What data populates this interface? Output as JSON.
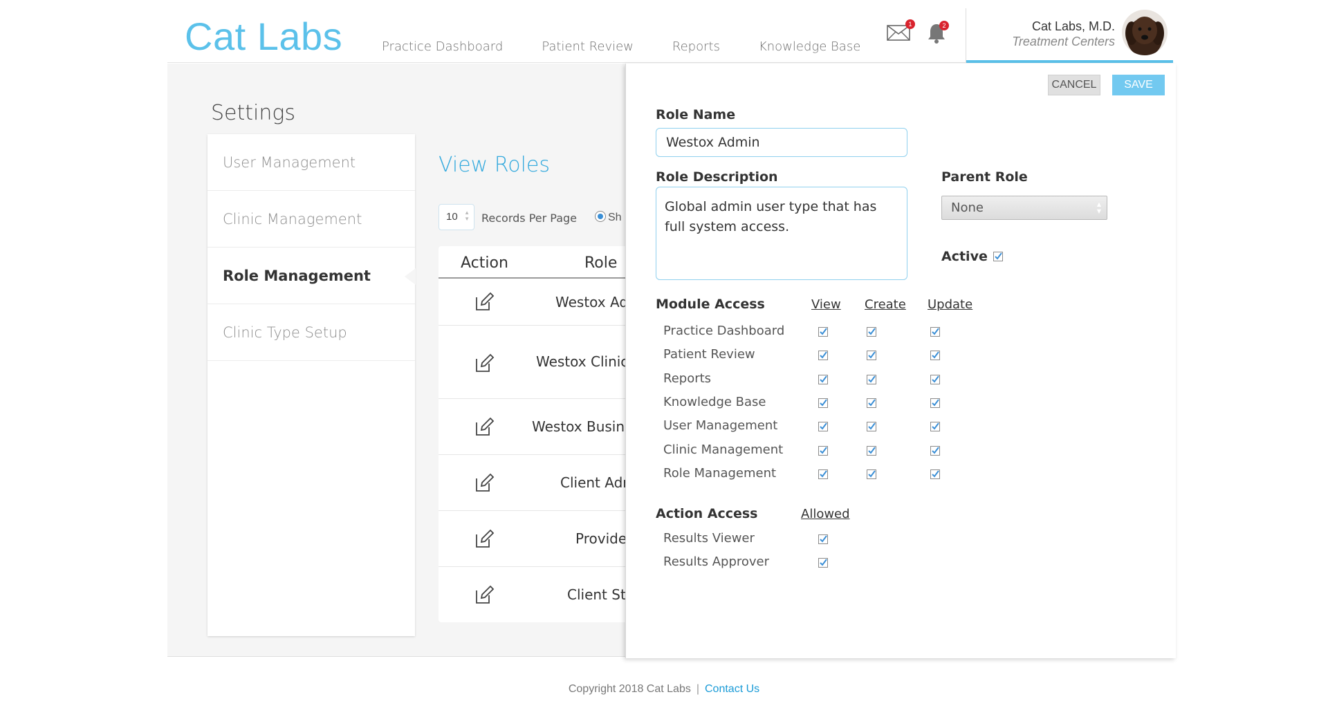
{
  "header": {
    "logo": "Cat Labs",
    "nav": [
      "Practice Dashboard",
      "Patient Review",
      "Reports",
      "Knowledge Base"
    ],
    "mail_count": "1",
    "notification_count": "2",
    "user_name": "Cat Labs, M.D.",
    "user_subtitle": "Treatment Centers"
  },
  "settings": {
    "title": "Settings",
    "menu": [
      "User Management",
      "Clinic Management",
      "Role Management",
      "Clinic Type Setup"
    ],
    "active_menu": "Role Management"
  },
  "roles": {
    "title": "View Roles",
    "records_per_page": "10",
    "records_label": "Records Per Page",
    "show_label": "Sho",
    "columns": [
      "Action",
      "Role"
    ],
    "rows": [
      "Westox Ad",
      "Westox Clinica",
      "Westox Busine",
      "Client Adr",
      "Provide",
      "Client Sta"
    ]
  },
  "panel": {
    "cancel_label": "CANCEL",
    "save_label": "SAVE",
    "role_name_label": "Role Name",
    "role_name_value": "Westox Admin",
    "role_description_label": "Role Description",
    "role_description_value": "Global admin user type that has full system access.",
    "parent_role_label": "Parent Role",
    "parent_role_value": "None",
    "active_label": "Active",
    "active_checked": true,
    "module_access_label": "Module Access",
    "module_columns": [
      "View",
      "Create",
      "Update"
    ],
    "modules": [
      "Practice Dashboard",
      "Patient Review",
      "Reports",
      "Knowledge Base",
      "User Management",
      "Clinic Management",
      "Role Management"
    ],
    "action_access_label": "Action Access",
    "action_column": "Allowed",
    "actions": [
      "Results Viewer",
      "Results Approver"
    ]
  },
  "footer": {
    "copyright": "Copyright 2018 Cat Labs",
    "separator": "|",
    "contact": "Contact Us"
  },
  "colors": {
    "brand": "#5bc1ea",
    "link": "#33a9dd",
    "save": "#72c9f0",
    "badge": "#d9232d",
    "checkbox": "#3b8fd6"
  },
  "icons": [
    "mail-icon",
    "bell-icon",
    "edit-icon",
    "checkbox-checked-icon",
    "select-arrows-icon"
  ]
}
